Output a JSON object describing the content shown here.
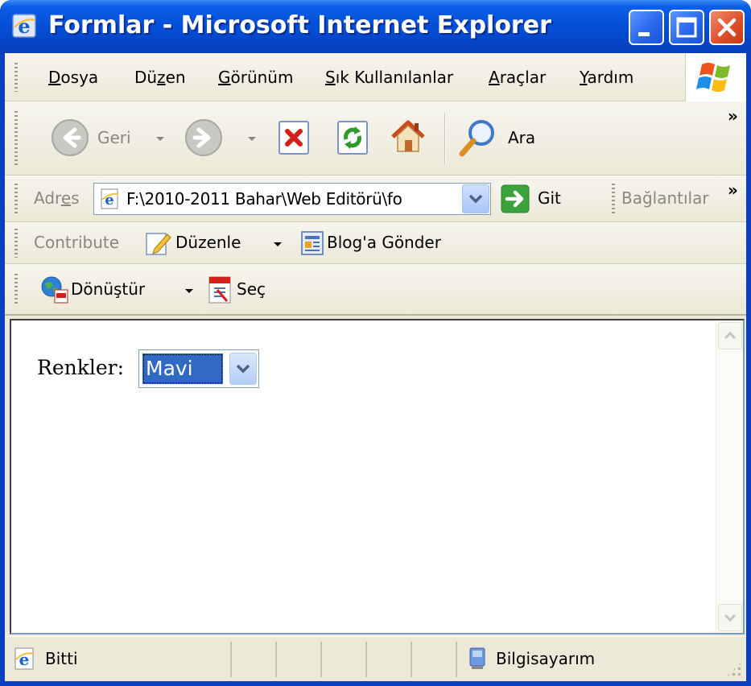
{
  "window": {
    "title": "Formlar - Microsoft Internet Explorer",
    "title_icon": "ie-icon",
    "buttons": [
      "minimize-icon",
      "maximize-icon",
      "close-icon"
    ]
  },
  "menu": {
    "items": [
      {
        "label": "Dosya",
        "underline": "D"
      },
      {
        "label": "Düzen",
        "underline": "z"
      },
      {
        "label": "Görünüm",
        "underline": "G"
      },
      {
        "label": "Sık Kullanılanlar",
        "underline": "S"
      },
      {
        "label": "Araçlar",
        "underline": "A"
      },
      {
        "label": "Yardım",
        "underline": "Y"
      }
    ]
  },
  "toolbar": {
    "back_label": "Geri",
    "search_label": "Ara",
    "more": "»"
  },
  "address": {
    "label": "Adres",
    "value": "F:\\2010-2011 Bahar\\Web Editörü\\fo",
    "go_label": "Git",
    "links_label": "Bağlantılar",
    "more": "»"
  },
  "contribute": {
    "label": "Contribute",
    "edit_label": "Düzenle",
    "blog_label": "Blog'a Gönder"
  },
  "convert": {
    "convert_label": "Dönüştür",
    "select_label": "Seç"
  },
  "page": {
    "label": "Renkler:",
    "select_value": "Mavi"
  },
  "status": {
    "text": "Bitti",
    "zone": "Bilgisayarım"
  },
  "colors": {
    "titlebar": "#0551da",
    "chrome": "#ece9d8",
    "selection": "#316ac5"
  }
}
